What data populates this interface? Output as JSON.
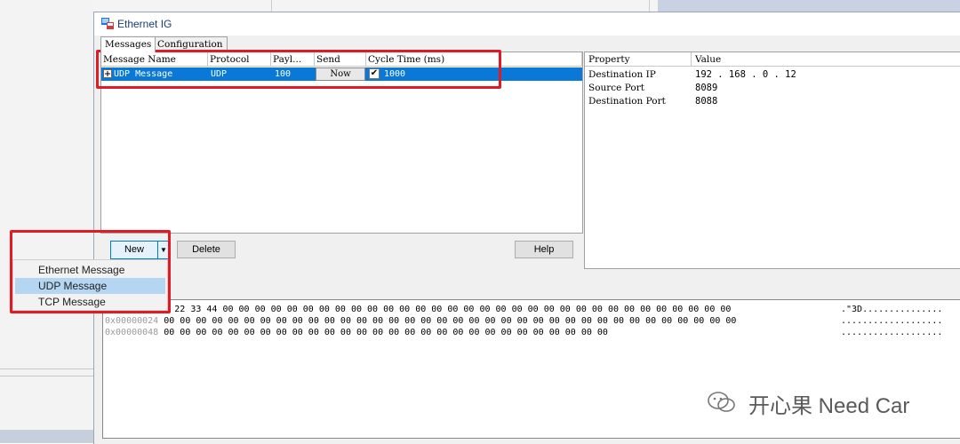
{
  "window": {
    "title": "Ethernet IG"
  },
  "tabs": [
    {
      "label": "Messages"
    },
    {
      "label": "Configuration"
    }
  ],
  "message_table": {
    "columns": [
      "Message Name",
      "Protocol",
      "Payl...",
      "Send",
      "Cycle Time (ms)"
    ],
    "rows": [
      {
        "name": "UDP Message",
        "protocol": "UDP",
        "payload": "100",
        "send": "Now",
        "cycle_enabled": true,
        "cycle_time": "1000"
      }
    ]
  },
  "properties": {
    "columns": [
      "Property",
      "Value"
    ],
    "rows": [
      {
        "property": "Destination IP",
        "value": "192 . 168 .  0 . 12"
      },
      {
        "property": "Source Port",
        "value": "8089"
      },
      {
        "property": "Destination Port",
        "value": "8088"
      }
    ]
  },
  "buttons": {
    "new": "New",
    "delete": "Delete",
    "help": "Help"
  },
  "new_menu": {
    "items": [
      "Ethernet Message",
      "UDP Message",
      "TCP Message"
    ],
    "selected": "UDP Message"
  },
  "hex": {
    "lines": [
      {
        "address": "",
        "bytes": "11 22 33 44 00 00 00 00 00 00 00 00 00 00 00 00 00 00 00 00 00 00 00 00 00 00 00 00 00 00 00 00 00 00 00 00",
        "ascii": ".\"3D..............."
      },
      {
        "address": "0x00000024",
        "bytes": "00 00 00 00 00 00 00 00 00 00 00 00 00 00 00 00 00 00 00 00 00 00 00 00 00 00 00 00 00 00 00 00 00 00 00 00",
        "ascii": "..................."
      },
      {
        "address": "0x00000048",
        "bytes": "00 00 00 00 00 00 00 00 00 00 00 00 00 00 00 00 00 00 00 00 00 00 00 00 00 00 00 00",
        "ascii": "..................."
      }
    ]
  },
  "watermark": {
    "text": "开心果 Need Car"
  },
  "colors": {
    "selection": "#0a78d7",
    "highlight_box": "#e01b24",
    "menu_selected": "#b4d6f2"
  }
}
